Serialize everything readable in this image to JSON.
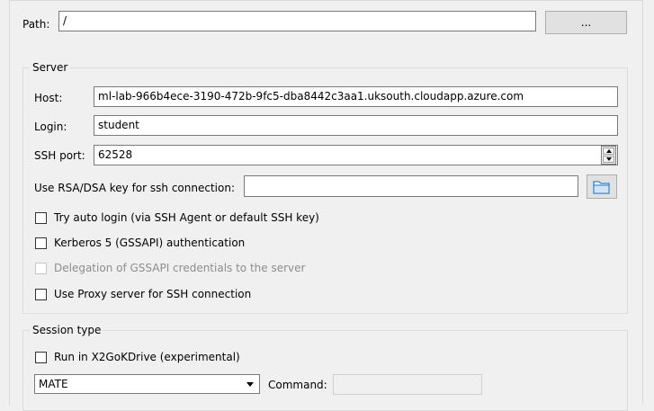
{
  "path": {
    "label": "Path:",
    "value": "/",
    "browse_label": "..."
  },
  "server": {
    "title": "Server",
    "host": {
      "label": "Host:",
      "value": "ml-lab-966b4ece-3190-472b-9fc5-dba8442c3aa1.uksouth.cloudapp.azure.com"
    },
    "login": {
      "label": "Login:",
      "value": "student"
    },
    "ssh_port": {
      "label": "SSH port:",
      "value": "62528"
    },
    "rsa_key": {
      "label": "Use RSA/DSA key for ssh connection:",
      "value": ""
    },
    "options": [
      {
        "label": "Try auto login (via SSH Agent or default SSH key)",
        "checked": false,
        "enabled": true
      },
      {
        "label": "Kerberos 5 (GSSAPI) authentication",
        "checked": false,
        "enabled": true
      },
      {
        "label": "Delegation of GSSAPI credentials to the server",
        "checked": false,
        "enabled": false
      },
      {
        "label": "Use Proxy server for SSH connection",
        "checked": false,
        "enabled": true
      }
    ]
  },
  "session": {
    "title": "Session type",
    "x2gokdrive": {
      "label": "Run in X2GoKDrive (experimental)",
      "checked": false
    },
    "type_value": "MATE",
    "command": {
      "label": "Command:",
      "value": ""
    }
  },
  "colors": {
    "folder_icon": "#4a90d9"
  }
}
